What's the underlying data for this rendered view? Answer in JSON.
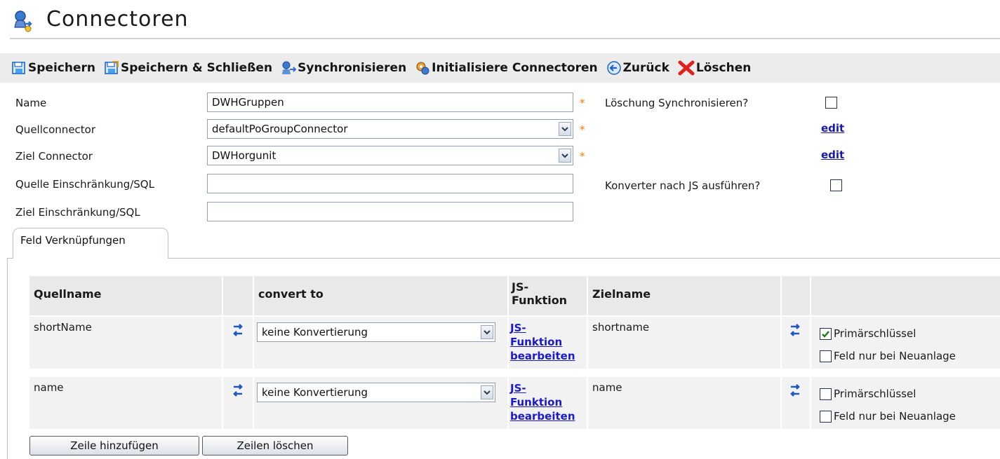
{
  "page": {
    "title": "Connectoren"
  },
  "toolbar": {
    "save": "Speichern",
    "save_close": "Speichern & Schließen",
    "sync": "Synchronisieren",
    "init": "Initialisiere Connectoren",
    "back": "Zurück",
    "delete": "Löschen"
  },
  "form": {
    "name_label": "Name",
    "name_value": "DWHGruppen",
    "source_label": "Quellconnector",
    "source_value": "defaultPoGroupConnector",
    "target_label": "Ziel Connector",
    "target_value": "DWHorgunit",
    "source_sql_label": "Quelle Einschränkung/SQL",
    "source_sql_value": "",
    "target_sql_label": "Ziel Einschränkung/SQL",
    "target_sql_value": "",
    "delete_sync_label": "Löschung Synchronisieren?",
    "converter_label": "Konverter nach JS ausführen?",
    "edit1": "edit",
    "edit2": "edit",
    "required": "*"
  },
  "tab": {
    "label": "Feld Verknüpfungen"
  },
  "table": {
    "headers": {
      "source": "Quellname",
      "convert": "convert to",
      "js_line1": "JS-",
      "js_line2": "Funktion",
      "target": "Zielname"
    },
    "rows": [
      {
        "source": "shortName",
        "convert": "keine Konvertierung",
        "js1": "JS-",
        "js2": "Funktion",
        "js3": "bearbeiten",
        "target": "shortname",
        "pk_label": "Primärschlüssel",
        "pk_checked": true,
        "new_label": "Feld nur bei Neuanlage"
      },
      {
        "source": "name",
        "convert": "keine Konvertierung",
        "js1": "JS-",
        "js2": "Funktion",
        "js3": "bearbeiten",
        "target": "name",
        "pk_label": "Primärschlüssel",
        "pk_checked": false,
        "new_label": "Feld nur bei Neuanlage"
      }
    ]
  },
  "buttons": {
    "add_row": "Zeile hinzufügen",
    "delete_rows": "Zeilen löschen"
  }
}
